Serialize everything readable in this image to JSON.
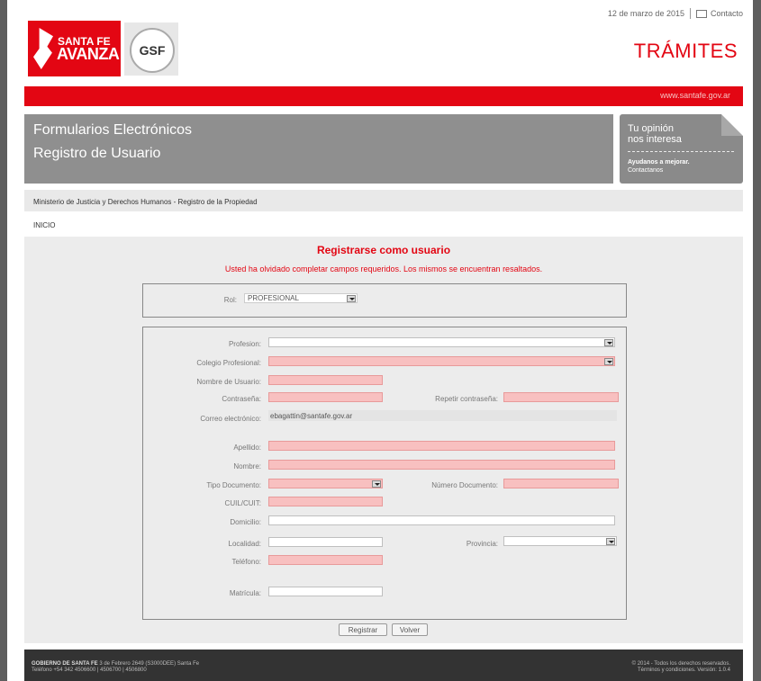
{
  "header": {
    "date": "12 de marzo de 2015",
    "contact_label": "Contacto",
    "logo_text_line1": "SANTA FE",
    "logo_text_line2": "AVANZA",
    "logo2_text": "GSF",
    "tramites": "TRÁMITES",
    "url": "www.santafe.gov.ar"
  },
  "banner": {
    "line1": "Formularios Electrónicos",
    "line2": "Registro de Usuario"
  },
  "opinion": {
    "line1": "Tu opinión",
    "line2": "nos interesa",
    "line3": "Ayudanos a mejorar.",
    "line4": "Contactanos"
  },
  "breadcrumb": "Ministerio de Justicia y Derechos Humanos - Registro de la Propiedad",
  "inicio": "INICIO",
  "form": {
    "title": "Registrarse como usuario",
    "error": "Usted ha olvidado completar campos requeridos. Los mismos se encuentran resaltados.",
    "rol_label": "Rol:",
    "rol_value": "PROFESIONAL",
    "profesion_label": "Profesion:",
    "colegio_label": "Colegio Profesional:",
    "usuario_label": "Nombre de Usuario:",
    "contrasena_label": "Contraseña:",
    "repetir_label": "Repetir contraseña:",
    "correo_label": "Correo electrónico:",
    "correo_value": "ebagattin@santafe.gov.ar",
    "apellido_label": "Apellido:",
    "nombre_label": "Nombre:",
    "tipo_doc_label": "Tipo Documento:",
    "numero_doc_label": "Número Documento:",
    "cuil_label": "CUIL/CUIT:",
    "domicilio_label": "Domicilio:",
    "localidad_label": "Localidad:",
    "provincia_label": "Provincia:",
    "telefono_label": "Teléfono:",
    "matricula_label": "Matrícula:",
    "register_button": "Registrar",
    "back_button": "Volver"
  },
  "footer": {
    "left_bold": "GOBIERNO DE SANTA FE",
    "left_line1_rest": "3 de Febrero 2649 (S3000DEE) Santa Fe",
    "left_line2": "Teléfono +54 342 4506600 | 4506700 | 4506800",
    "right_line1": "© 2014 - Todos los derechos reservados.",
    "right_line2": "Términos y condiciones. Versión: 1.0.4"
  },
  "colors": {
    "brand_red": "#e30613",
    "required_field": "#f8c0c0",
    "banner_gray": "#8f8f8f"
  }
}
